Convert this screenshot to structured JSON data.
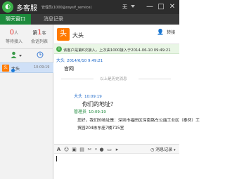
{
  "titlebar": {
    "app_title": "多客服",
    "account_text": "管理员(1000@osysif_service)",
    "status": "无",
    "minimize": "—",
    "maximize": "□",
    "close": "✕"
  },
  "tabs": [
    {
      "label": "聊天窗口",
      "active": true
    },
    {
      "label": "消息记录",
      "active": false
    }
  ],
  "left_panel": {
    "waiting": {
      "count": "0",
      "unit": "人",
      "label": "等待接入"
    },
    "sessions": {
      "count": "1",
      "unit": "客",
      "label": "会话列表"
    },
    "toolbar": {
      "user_icon": "user-icon",
      "clock_icon": "clock-icon"
    },
    "conversations": [
      {
        "name": "大头",
        "time": "10:09:19",
        "avatar_text": "头",
        "selected": true
      }
    ]
  },
  "chat_header": {
    "avatar_text": "头",
    "name": "大头",
    "transfer_label": "转接"
  },
  "notice": {
    "text": "该客户是第6次接入，上次由1000接入于2014-06-10 09:49:21"
  },
  "messages": {
    "first": {
      "sender": "大头",
      "time": "2014/6/10 9:49:21",
      "text": "官网"
    },
    "history_divider": "以上是历史消息",
    "second": {
      "sender": "大头",
      "time": "10:09:19",
      "text": "你们的地址？"
    },
    "reply": {
      "sender": "管理员",
      "time": "10:09:19",
      "line1": "您好，我们的地址是：深圳市福田区深南路车公庙工业区（泰然）工",
      "line2": "贸园204栋东座7楼715室"
    }
  },
  "input_toolbar": {
    "record_label": "消息记录"
  },
  "colors": {
    "accent_green": "#1d8a3c",
    "titlebar_bg": "#2c2c2c",
    "link_blue": "#1a66c8",
    "notice_bg": "#e9f6e5",
    "avatar_orange": "#ff7a00",
    "stat_red": "#e53935"
  }
}
